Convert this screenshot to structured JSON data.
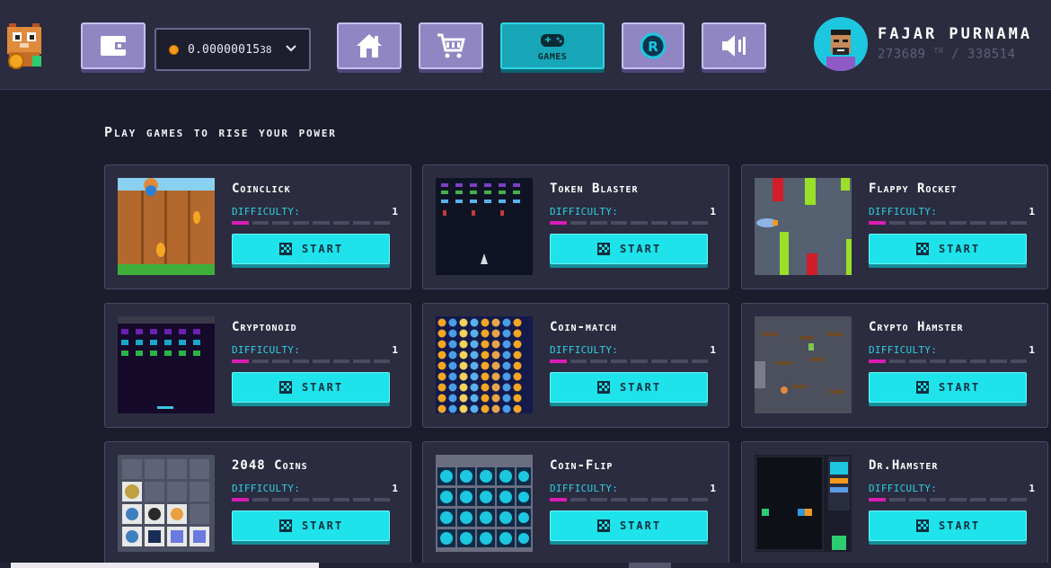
{
  "header": {
    "balance": {
      "main": "0.00000015",
      "small": "38"
    },
    "nav": {
      "games_label": "GAMES"
    },
    "user": {
      "name": "FAJAR PURNAMA",
      "power": "273689",
      "power_unit": "TH",
      "power_sep": "/",
      "power_max": "338514"
    }
  },
  "section": {
    "title": "Play games to rise your power"
  },
  "common": {
    "difficulty_label": "DIFFICULTY:",
    "start_label": "START"
  },
  "games": [
    {
      "title": "Coinclick",
      "difficulty": "1",
      "difficulty_level": 1,
      "thumb": "coinclick"
    },
    {
      "title": "Token Blaster",
      "difficulty": "1",
      "difficulty_level": 1,
      "thumb": "space"
    },
    {
      "title": "Flappy Rocket",
      "difficulty": "1",
      "difficulty_level": 1,
      "thumb": "flappy"
    },
    {
      "title": "Cryptonoid",
      "difficulty": "1",
      "difficulty_level": 1,
      "thumb": "arkanoid"
    },
    {
      "title": "Coin-match",
      "difficulty": "1",
      "difficulty_level": 1,
      "thumb": "match"
    },
    {
      "title": "Crypto Hamster",
      "difficulty": "1",
      "difficulty_level": 1,
      "thumb": "hamster"
    },
    {
      "title": "2048 Coins",
      "difficulty": "1",
      "difficulty_level": 1,
      "thumb": "2048"
    },
    {
      "title": "Coin-Flip",
      "difficulty": "1",
      "difficulty_level": 1,
      "thumb": "flip"
    },
    {
      "title": "Dr.Hamster",
      "difficulty": "1",
      "difficulty_level": 1,
      "thumb": "drhamster"
    }
  ],
  "colors": {
    "accent": "#1ee3ea",
    "difficulty_on": "#d91cb4",
    "background": "#1c1d2c",
    "card": "#2b2c40"
  }
}
